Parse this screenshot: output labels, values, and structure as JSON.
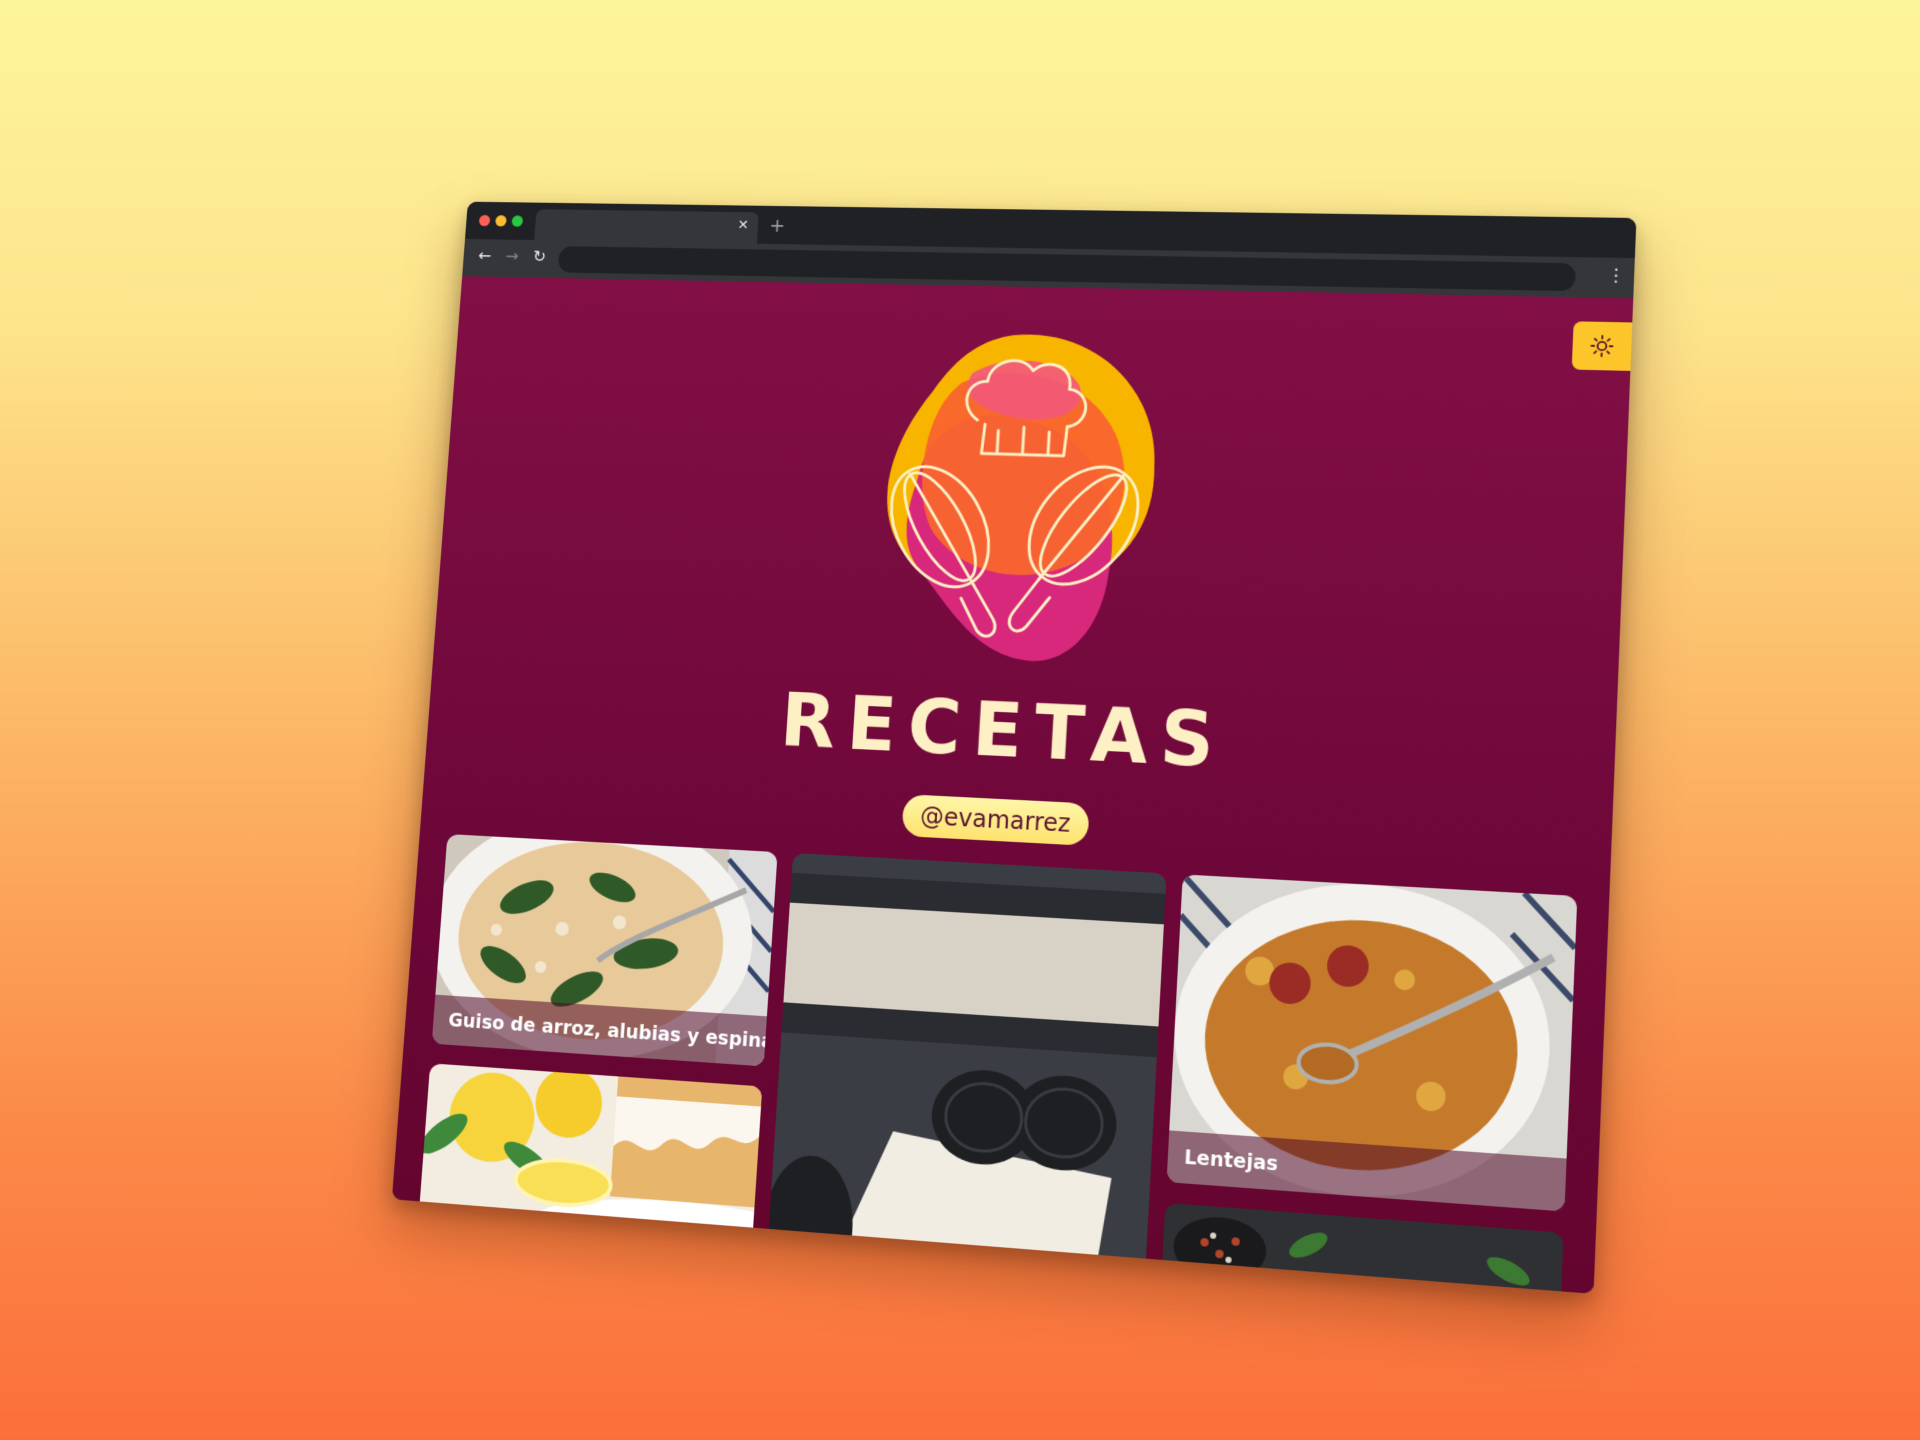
{
  "colors": {
    "page_bg": "#7c0d43",
    "accent_yellow": "#fcc62a",
    "title_cream": "#fdf0c4"
  },
  "browser": {
    "tab_close_glyph": "✕",
    "new_tab_glyph": "+",
    "nav": {
      "back_icon": "arrow-left-icon",
      "forward_icon": "arrow-right-icon",
      "reload_icon": "reload-icon",
      "menu_icon": "kebab-menu-icon"
    }
  },
  "header": {
    "title": "RECETAS",
    "handle": "@evamarrez"
  },
  "theme_toggle": {
    "icon": "sun-icon"
  },
  "recipes": [
    {
      "title": "Guiso de arroz, alubias y espinacas"
    },
    {
      "title": ""
    },
    {
      "title": ""
    },
    {
      "title": "Lentejas"
    },
    {
      "title": ""
    }
  ]
}
